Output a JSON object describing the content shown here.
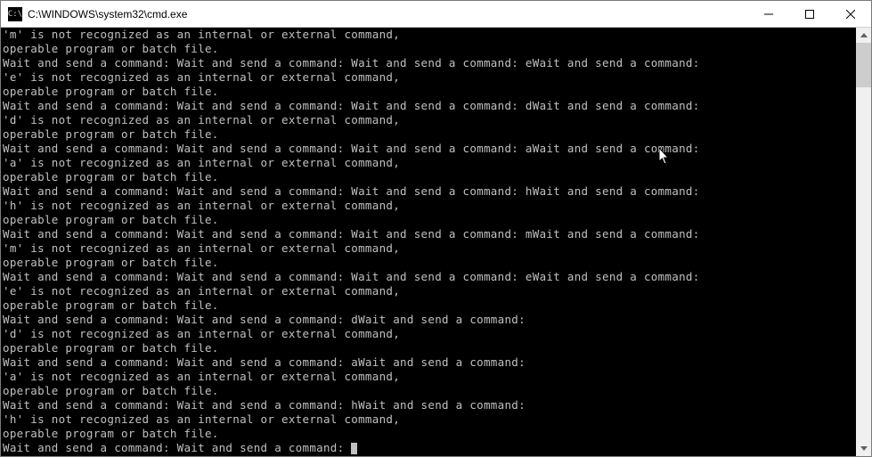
{
  "window": {
    "title": "C:\\WINDOWS\\system32\\cmd.exe",
    "icon_label": "cmd-icon"
  },
  "controls": {
    "minimize": "—",
    "maximize": "□",
    "close": "✕"
  },
  "console_lines": [
    "'m' is not recognized as an internal or external command,",
    "operable program or batch file.",
    "Wait and send a command: Wait and send a command: Wait and send a command: eWait and send a command:",
    "'e' is not recognized as an internal or external command,",
    "operable program or batch file.",
    "Wait and send a command: Wait and send a command: Wait and send a command: dWait and send a command:",
    "'d' is not recognized as an internal or external command,",
    "operable program or batch file.",
    "Wait and send a command: Wait and send a command: Wait and send a command: aWait and send a command:",
    "'a' is not recognized as an internal or external command,",
    "operable program or batch file.",
    "Wait and send a command: Wait and send a command: Wait and send a command: hWait and send a command:",
    "'h' is not recognized as an internal or external command,",
    "operable program or batch file.",
    "Wait and send a command: Wait and send a command: Wait and send a command: mWait and send a command:",
    "'m' is not recognized as an internal or external command,",
    "operable program or batch file.",
    "Wait and send a command: Wait and send a command: Wait and send a command: eWait and send a command:",
    "'e' is not recognized as an internal or external command,",
    "operable program or batch file.",
    "Wait and send a command: Wait and send a command: dWait and send a command:",
    "'d' is not recognized as an internal or external command,",
    "operable program or batch file.",
    "Wait and send a command: Wait and send a command: aWait and send a command:",
    "'a' is not recognized as an internal or external command,",
    "operable program or batch file.",
    "Wait and send a command: Wait and send a command: hWait and send a command:",
    "'h' is not recognized as an internal or external command,",
    "operable program or batch file.",
    "Wait and send a command: Wait and send a command: "
  ]
}
